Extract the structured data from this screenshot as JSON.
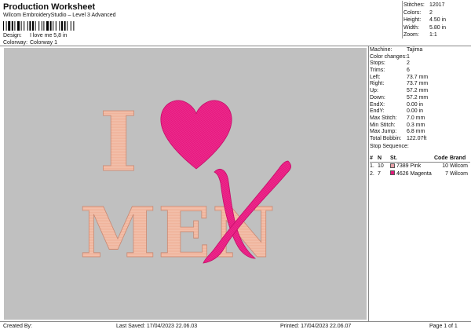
{
  "header": {
    "title": "Production Worksheet",
    "subtitle": "Wilcom EmbroideryStudio – Level 3 Advanced",
    "design_label": "Design:",
    "design_value": "I love me 5,8 in",
    "colorway_label": "Colorway:",
    "colorway_value": "Colorway 1"
  },
  "summary": [
    {
      "label": "Stitches:",
      "value": "12017"
    },
    {
      "label": "Colors:",
      "value": "2"
    },
    {
      "label": "Height:",
      "value": "4.50 in"
    },
    {
      "label": "Width:",
      "value": "5.80 in"
    },
    {
      "label": "Zoom:",
      "value": "1:1"
    }
  ],
  "details": [
    {
      "label": "Machine:",
      "value": "Tajima"
    },
    {
      "label": "Color changes:",
      "value": "1"
    },
    {
      "label": "Stops:",
      "value": "2"
    },
    {
      "label": "Trims:",
      "value": "6"
    },
    {
      "label": "Left:",
      "value": "73.7 mm"
    },
    {
      "label": "Right:",
      "value": "73.7 mm"
    },
    {
      "label": "Up:",
      "value": "57.2 mm"
    },
    {
      "label": "Down:",
      "value": "57.2 mm"
    },
    {
      "label": "EndX:",
      "value": "0.00 in"
    },
    {
      "label": "EndY:",
      "value": "0.00 in"
    },
    {
      "label": "Max Stitch:",
      "value": "7.0 mm"
    },
    {
      "label": "Min Stitch:",
      "value": "0.3 mm"
    },
    {
      "label": "Max Jump:",
      "value": "6.8 mm"
    },
    {
      "label": "Total Bobbin:",
      "value": "122.07ft"
    }
  ],
  "stop_sequence": {
    "title": "Stop Sequence:",
    "columns": [
      "#",
      "N",
      "St.",
      "Code",
      "Brand"
    ],
    "rows": [
      {
        "index": "1.",
        "n": "10",
        "code_num": "7389",
        "name": "Pink",
        "st": "10",
        "brand": "Wilcom",
        "color": "#e8a0a8"
      },
      {
        "index": "2.",
        "n": "7",
        "code_num": "4626",
        "name": "Magenta",
        "st": "7",
        "brand": "Wilcom",
        "color": "#e0187a"
      }
    ]
  },
  "design_art": {
    "line1_letter": "I",
    "line2_letters": "MEN",
    "peach_color": "#f0b49c",
    "magenta_color": "#e8147e"
  },
  "footer": {
    "created_by": "Created By:",
    "last_saved": "Last Saved: 17/04/2023 22.06.03",
    "printed": "Printed: 17/04/2023 22.06.07",
    "page": "Page 1 of 1"
  }
}
